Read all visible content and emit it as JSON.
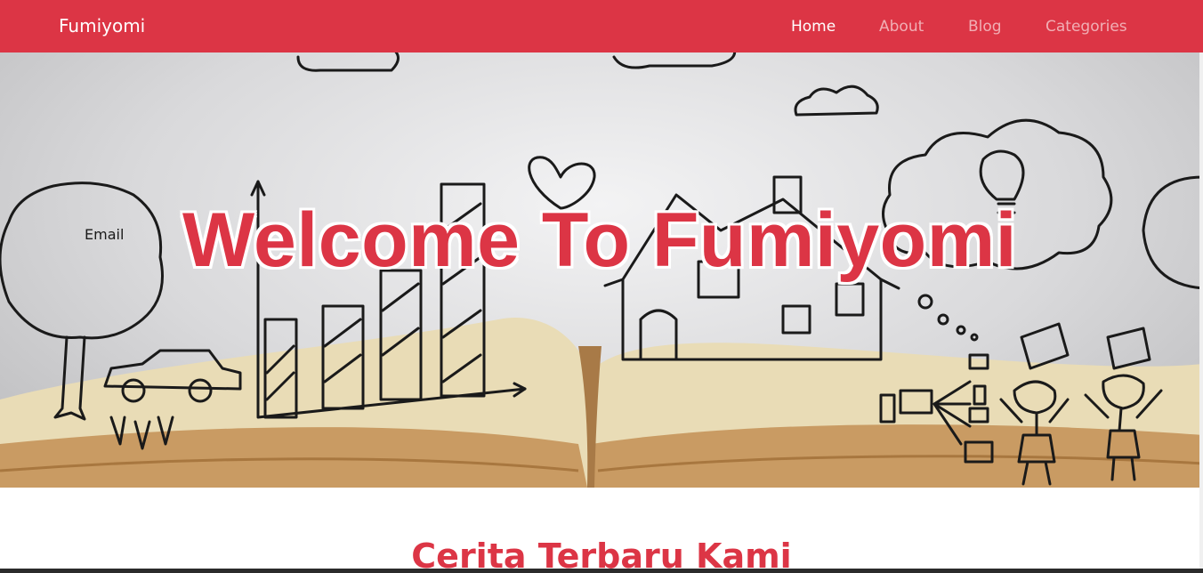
{
  "navbar": {
    "brand": "Fumiyomi",
    "links": [
      {
        "label": "Home",
        "active": true
      },
      {
        "label": "About",
        "active": false
      },
      {
        "label": "Blog",
        "active": false
      },
      {
        "label": "Categories",
        "active": false
      }
    ]
  },
  "hero": {
    "title": "Welcome To Fumiyomi",
    "image_description_icon": "open-book-doodles-illustration"
  },
  "section": {
    "title": "Cerita Terbaru Kami"
  },
  "colors": {
    "primary": "#dc3545",
    "nav_text": "#ffffff",
    "nav_text_muted": "rgba(255,255,255,0.6)",
    "page_background": "#ffffff"
  }
}
